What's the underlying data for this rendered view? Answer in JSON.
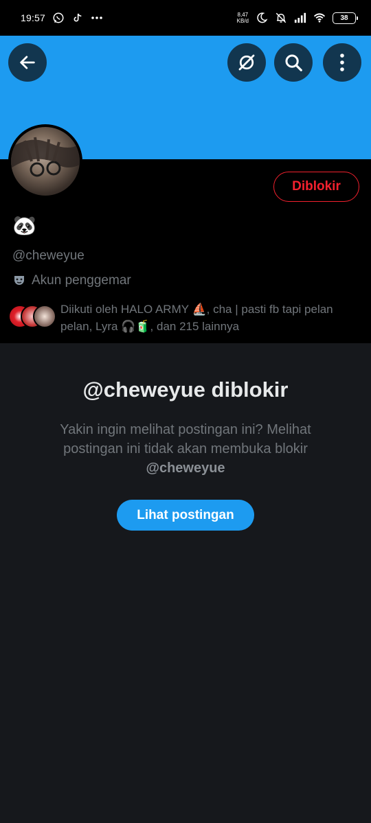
{
  "status_bar": {
    "time": "19:57",
    "net_speed_value": "8,47",
    "net_speed_unit": "KB/d",
    "battery": "38",
    "left_icons": [
      "paw-icon",
      "whatsapp-icon",
      "tiktok-icon",
      "more-dots-icon"
    ],
    "right_icons": [
      "moon-icon",
      "bell-off-icon",
      "signal-icon",
      "wifi-icon",
      "battery-icon"
    ]
  },
  "header": {
    "banner_color": "#1d9bf0",
    "buttons": [
      "back-arrow-icon",
      "grok-icon",
      "search-icon",
      "more-vertical-icon"
    ]
  },
  "profile": {
    "display_name": "🐼",
    "handle": "@cheweyue",
    "category_label": "Akun penggemar",
    "blocked_button_label": "Diblokir",
    "followed_by_text": "Diikuti oleh HALO ARMY ⛵, cha | pasti fb tapi pelan pelan, Lyra 🎧🧃, dan 215 lainnya"
  },
  "blocked_notice": {
    "title": "@cheweyue diblokir",
    "description": "Yakin ingin melihat postingan ini? Melihat postingan ini tidak akan membuka blokir",
    "description_handle": "@cheweyue",
    "button_label": "Lihat postingan"
  },
  "colors": {
    "accent": "#1d9bf0",
    "blocked_red": "#f4212e",
    "secondary_text": "#71767b"
  }
}
